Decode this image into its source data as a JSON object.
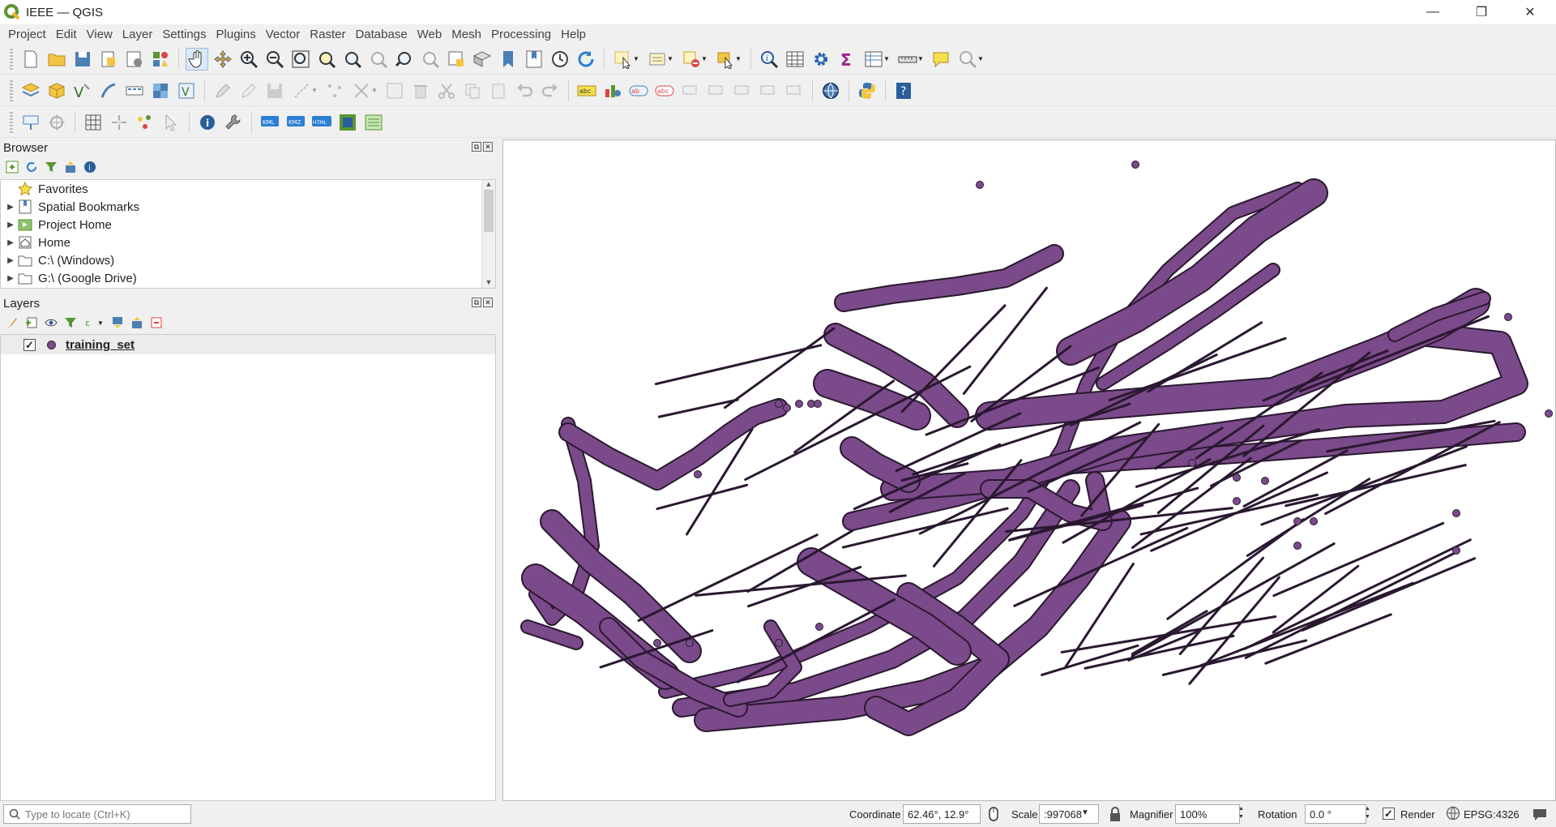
{
  "window": {
    "title": "IEEE — QGIS",
    "accent": "#589632"
  },
  "menu": [
    "Project",
    "Edit",
    "View",
    "Layer",
    "Settings",
    "Plugins",
    "Vector",
    "Raster",
    "Database",
    "Web",
    "Mesh",
    "Processing",
    "Help"
  ],
  "browser": {
    "title": "Browser",
    "items": [
      {
        "label": "Favorites",
        "icon": "star-icon"
      },
      {
        "label": "Spatial Bookmarks",
        "icon": "bookmark-icon"
      },
      {
        "label": "Project Home",
        "icon": "project-home-icon"
      },
      {
        "label": "Home",
        "icon": "home-icon"
      },
      {
        "label": "C:\\ (Windows)",
        "icon": "folder-icon"
      },
      {
        "label": "G:\\ (Google Drive)",
        "icon": "folder-icon"
      }
    ]
  },
  "layers": {
    "title": "Layers",
    "items": [
      {
        "label": "training_set",
        "checked": true,
        "color": "#7b4a8a"
      }
    ]
  },
  "map": {
    "point_color": "#7b4a8a",
    "outline_color": "#2a1830"
  },
  "status": {
    "locate_placeholder": "Type to locate (Ctrl+K)",
    "coordinate_label": "Coordinate",
    "coordinate_value": "62.46°, 12.9°",
    "scale_label": "Scale",
    "scale_value": ":997068",
    "magnifier_label": "Magnifier",
    "magnifier_value": "100%",
    "rotation_label": "Rotation",
    "rotation_value": "0.0 °",
    "render_label": "Render",
    "crs": "EPSG:4326"
  }
}
